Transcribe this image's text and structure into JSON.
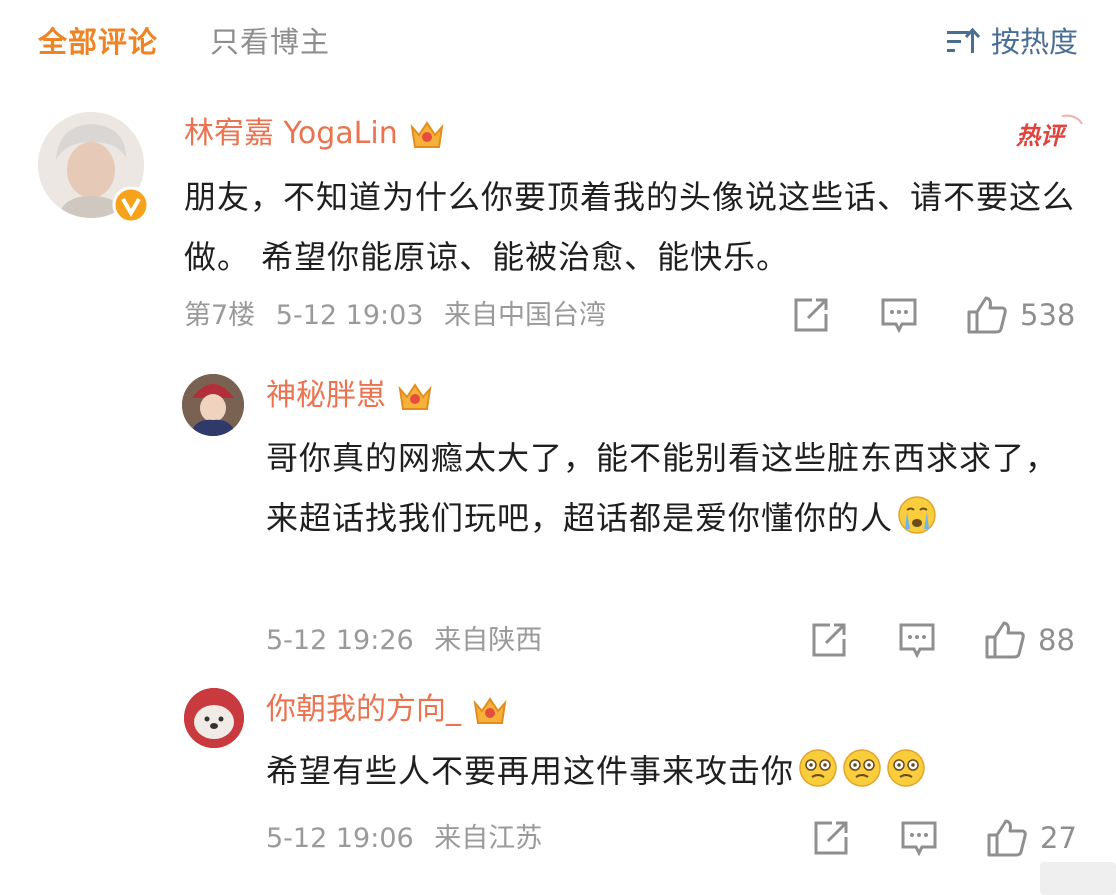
{
  "tabs": {
    "all_comments": "全部评论",
    "blogger_only": "只看博主",
    "sort_label": "按热度"
  },
  "comments": [
    {
      "username": "林宥嘉 YogaLin",
      "badge": "热评",
      "text": "朋友，不知道为什么你要顶着我的头像说这些话、请不要这么做。 希望你能原谅、能被治愈、能快乐。",
      "floor": "第7楼",
      "time": "5-12 19:03",
      "location": "来自中国台湾",
      "likes": "538"
    },
    {
      "username": "神秘胖崽",
      "text": "哥你真的网瘾太大了，能不能别看这些脏东西求求了，来超话找我们玩吧，超话都是爱你懂你的人",
      "emoji": "crying-face-emoji",
      "time": "5-12 19:26",
      "location": "来自陕西",
      "likes": "88"
    },
    {
      "username": "你朝我的方向_",
      "text": "希望有些人不要再用这件事来攻击你",
      "emoji": "dizzy-face-emoji",
      "time": "5-12 19:06",
      "location": "来自江苏",
      "likes": "27"
    }
  ],
  "colors": {
    "accent": "#f08324",
    "username": "#eb7350",
    "link_blue": "#4a6d96",
    "muted": "#9a9a9a",
    "hot_red": "#e2423c"
  }
}
